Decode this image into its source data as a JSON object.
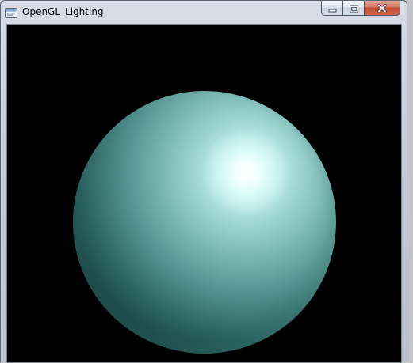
{
  "window": {
    "title": "OpenGL_Lighting",
    "controls": {
      "minimize_icon": "minimize-icon",
      "maximize_icon": "maximize-icon",
      "close_icon": "close-icon"
    }
  },
  "viewport": {
    "background_color": "#000000",
    "object": "lit-sphere",
    "sphere_base_color": "#2f6f6b",
    "specular_color": "#ffffff"
  },
  "colors": {
    "close_button": "#c2482f",
    "title_bar": "#c4ccd8"
  }
}
